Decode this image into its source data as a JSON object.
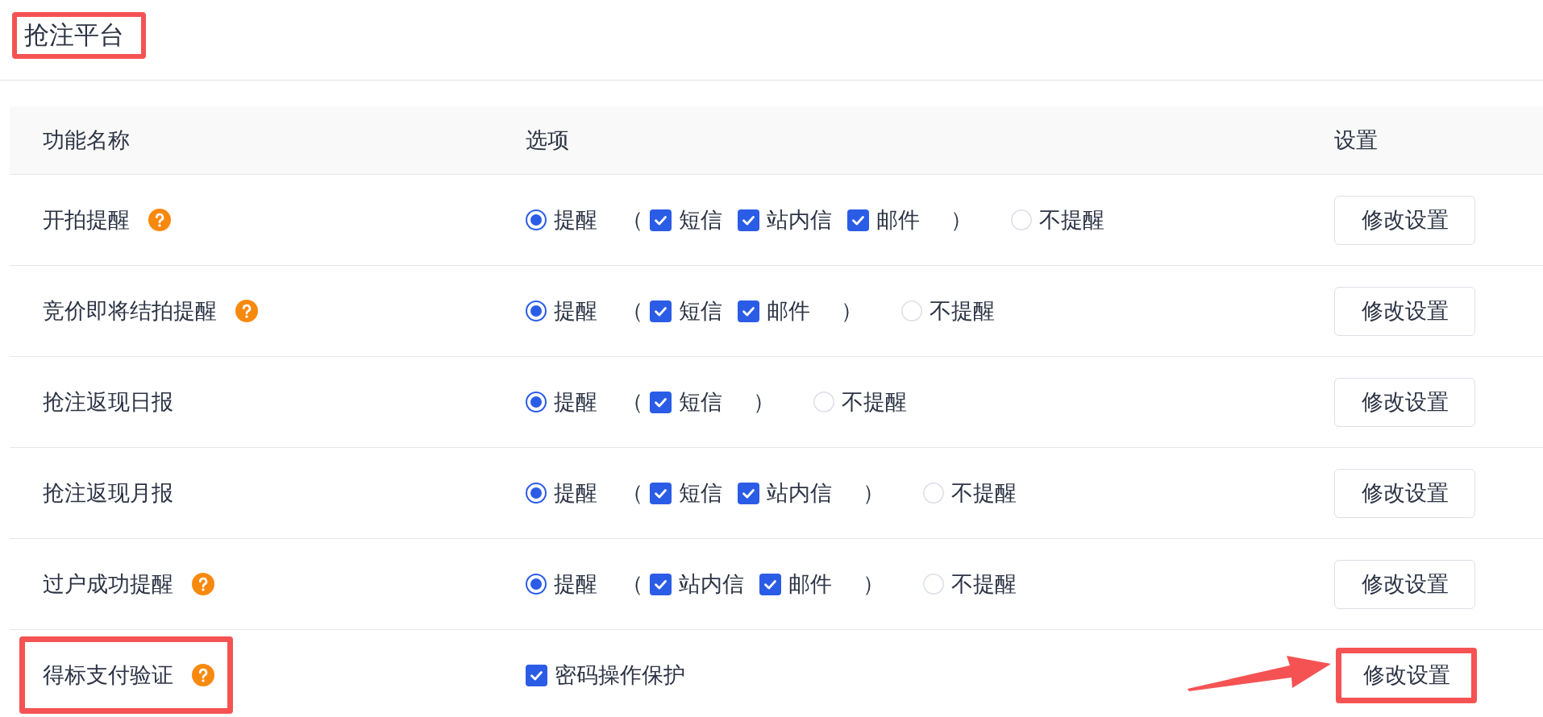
{
  "title": {
    "text": "抢注平台",
    "highlighted": true
  },
  "table": {
    "columns": [
      "功能名称",
      "选项",
      "设置"
    ],
    "rows": [
      {
        "name": "开拍提醒",
        "help": true,
        "highlighted": false,
        "options": {
          "kind": "radio_group",
          "choices": [
            {
              "label": "提醒",
              "selected": true
            },
            {
              "label": "不提醒",
              "selected": false
            }
          ],
          "open_bracket": "（",
          "close_bracket": "）",
          "channels": [
            {
              "label": "短信",
              "checked": true
            },
            {
              "label": "站内信",
              "checked": true
            },
            {
              "label": "邮件",
              "checked": true
            }
          ]
        },
        "button": {
          "label": "修改设置",
          "highlighted": false,
          "arrow": false
        }
      },
      {
        "name": "竞价即将结拍提醒",
        "help": true,
        "highlighted": false,
        "options": {
          "kind": "radio_group",
          "choices": [
            {
              "label": "提醒",
              "selected": true
            },
            {
              "label": "不提醒",
              "selected": false
            }
          ],
          "open_bracket": "（",
          "close_bracket": "）",
          "channels": [
            {
              "label": "短信",
              "checked": true
            },
            {
              "label": "邮件",
              "checked": true
            }
          ]
        },
        "button": {
          "label": "修改设置",
          "highlighted": false,
          "arrow": false
        }
      },
      {
        "name": "抢注返现日报",
        "help": false,
        "highlighted": false,
        "options": {
          "kind": "radio_group",
          "choices": [
            {
              "label": "提醒",
              "selected": true
            },
            {
              "label": "不提醒",
              "selected": false
            }
          ],
          "open_bracket": "（",
          "close_bracket": "）",
          "channels": [
            {
              "label": "短信",
              "checked": true
            }
          ]
        },
        "button": {
          "label": "修改设置",
          "highlighted": false,
          "arrow": false
        }
      },
      {
        "name": "抢注返现月报",
        "help": false,
        "highlighted": false,
        "options": {
          "kind": "radio_group",
          "choices": [
            {
              "label": "提醒",
              "selected": true
            },
            {
              "label": "不提醒",
              "selected": false
            }
          ],
          "open_bracket": "（",
          "close_bracket": "）",
          "channels": [
            {
              "label": "短信",
              "checked": true
            },
            {
              "label": "站内信",
              "checked": true
            }
          ]
        },
        "button": {
          "label": "修改设置",
          "highlighted": false,
          "arrow": false
        }
      },
      {
        "name": "过户成功提醒",
        "help": true,
        "highlighted": false,
        "options": {
          "kind": "radio_group",
          "choices": [
            {
              "label": "提醒",
              "selected": true
            },
            {
              "label": "不提醒",
              "selected": false
            }
          ],
          "open_bracket": "（",
          "close_bracket": "）",
          "channels": [
            {
              "label": "站内信",
              "checked": true
            },
            {
              "label": "邮件",
              "checked": true
            }
          ]
        },
        "button": {
          "label": "修改设置",
          "highlighted": false,
          "arrow": false
        }
      },
      {
        "name": "得标支付验证",
        "help": true,
        "highlighted": true,
        "options": {
          "kind": "checkbox",
          "label": "密码操作保护",
          "checked": true
        },
        "button": {
          "label": "修改设置",
          "highlighted": true,
          "arrow": true
        }
      }
    ]
  }
}
